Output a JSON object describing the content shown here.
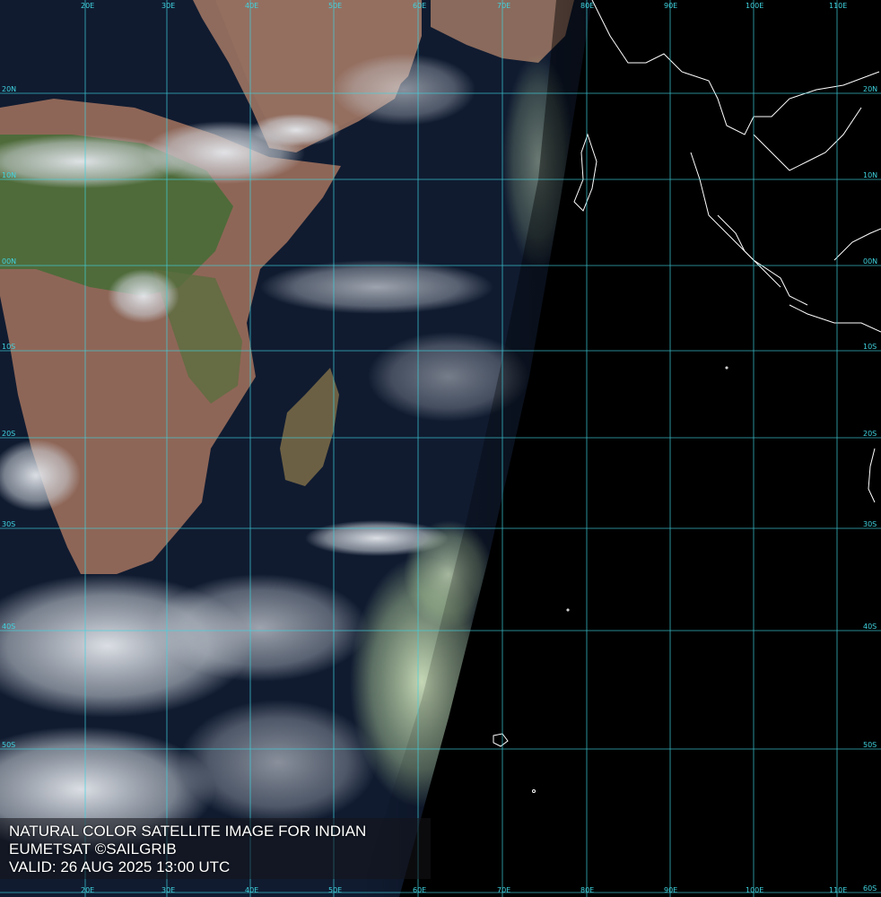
{
  "caption": {
    "line1": "NATURAL COLOR SATELLITE IMAGE FOR INDIAN",
    "line2": "EUMETSAT ©SAILGRIB",
    "line3": "VALID:  26 AUG 2025 13:00 UTC"
  },
  "grid": {
    "color": "#3fd4e0",
    "lon_labels": [
      "20E",
      "30E",
      "40E",
      "50E",
      "60E",
      "70E",
      "80E",
      "90E",
      "100E",
      "110E"
    ],
    "lat_labels_right": [
      "20N",
      "10N",
      "00N",
      "10S",
      "20S",
      "30S",
      "40S",
      "50S",
      "60S"
    ],
    "lat_labels_left": [
      "20N",
      "10N",
      "00N",
      "10S",
      "20S",
      "30S",
      "40S",
      "50S"
    ]
  },
  "colors": {
    "ocean": "#0f1a2e",
    "land_desert": "#8e6a5c",
    "land_green": "#4e6a3a",
    "cloud": "#d8dde4",
    "night": "#000000",
    "coast": "#ffffff"
  }
}
